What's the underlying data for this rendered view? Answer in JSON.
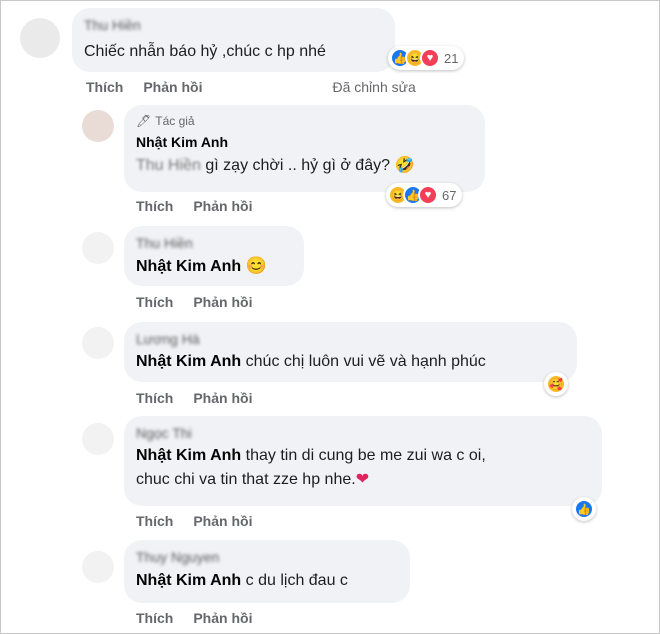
{
  "comment1": {
    "author": "Thu Hiền",
    "text": "Chiếc nhẫn báo hỷ ,chúc c hp nhé",
    "reaction_count": "21",
    "like_label": "Thích",
    "reply_label": "Phản hồi",
    "edited_label": "Đã chỉnh sửa"
  },
  "reply_author": {
    "tag_label": "Tác giả",
    "author": "Nhật Kim Anh",
    "mention": "Thu Hiền",
    "text": "gì zạy chời .. hỷ gì ở đây? 🤣",
    "reaction_count": "67",
    "like_label": "Thích",
    "reply_label": "Phản hồi"
  },
  "reply2": {
    "author": "Thu Hiền",
    "mention": "Nhật Kim Anh",
    "text": "😊",
    "like_label": "Thích",
    "reply_label": "Phản hồi"
  },
  "reply3": {
    "author": "Lương Hà",
    "mention": "Nhật Kim Anh",
    "text": "chúc chị luôn vui vẽ và hạnh phúc",
    "like_label": "Thích",
    "reply_label": "Phản hồi"
  },
  "reply4": {
    "author": "Ngọc Thi",
    "mention": "Nhật Kim Anh",
    "text_line1": "thay tin di cung be me zui wa c oi,",
    "text_line2": "chuc chi va tin that zze hp nhe.",
    "like_label": "Thích",
    "reply_label": "Phản hồi"
  },
  "reply5": {
    "author": "Thuy Nguyen",
    "mention": "Nhật Kim Anh",
    "text": "c du lịch đau c",
    "like_label": "Thích",
    "reply_label": "Phản hồi"
  },
  "colors": {
    "like_blue": "#1877f2",
    "bubble": "#f0f2f5",
    "muted": "#65676b"
  }
}
